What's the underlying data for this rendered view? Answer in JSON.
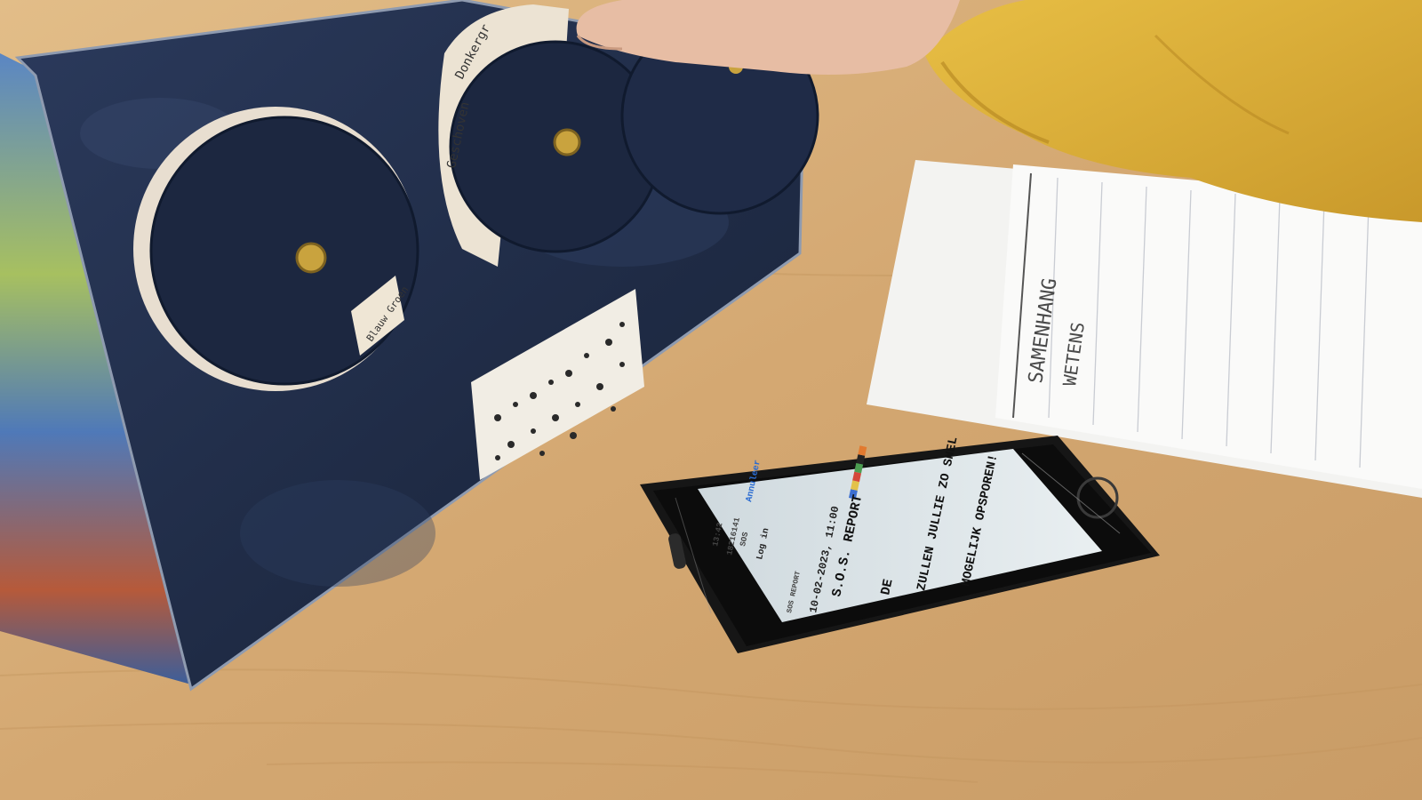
{
  "phone_screen": {
    "time": "13:42",
    "number": "1821‪614‪1",
    "sender": "SOS",
    "cancel": "Annuleer",
    "login": "Log in",
    "app_label": "SOS REPORT",
    "date": "10-02-2023, 11:00",
    "title": "S.O.S. REPORT",
    "line1": "DE",
    "line2": "ZULLEN JULLIE ZO SNEL",
    "line3": "MOGELIJK OPSPOREN!"
  },
  "dial_labels": {
    "label_a": "Donkergr",
    "label_b": "Geschoven",
    "label_c": "Blauw Groen"
  },
  "notebook": {
    "word1": "SAMENHANG",
    "word2": "WETENS"
  },
  "colors": {
    "table": "#d6ad78",
    "box": "#22304f",
    "sleeve": "#e0b33a",
    "phone_case": "#161616",
    "screen": "#dfe8ec"
  }
}
